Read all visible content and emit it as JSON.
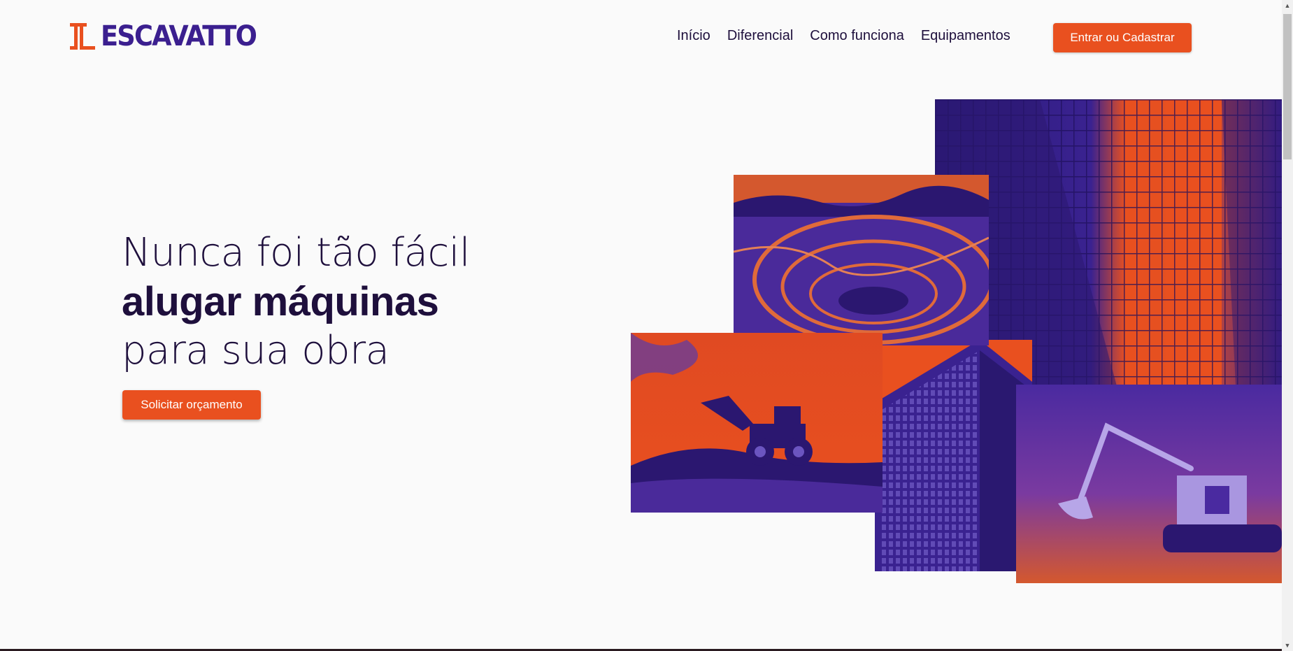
{
  "brand": {
    "name": "ESCAVATTO",
    "primary": "#3b1f8f",
    "accent": "#e9501f",
    "text": "#1e0f3c"
  },
  "nav": {
    "items": [
      {
        "label": "Início"
      },
      {
        "label": "Diferencial"
      },
      {
        "label": "Como funciona"
      },
      {
        "label": "Equipamentos"
      }
    ],
    "login_label": "Entrar ou Cadastrar"
  },
  "hero": {
    "line1": "Nunca foi tão fácil",
    "line2": "alugar máquinas",
    "line3": "para sua obra",
    "cta_label": "Solicitar orçamento"
  },
  "icons": {
    "logo": "escavatto-logo-icon",
    "scroll_up": "arrow-up-icon",
    "scroll_down": "arrow-down-icon"
  }
}
